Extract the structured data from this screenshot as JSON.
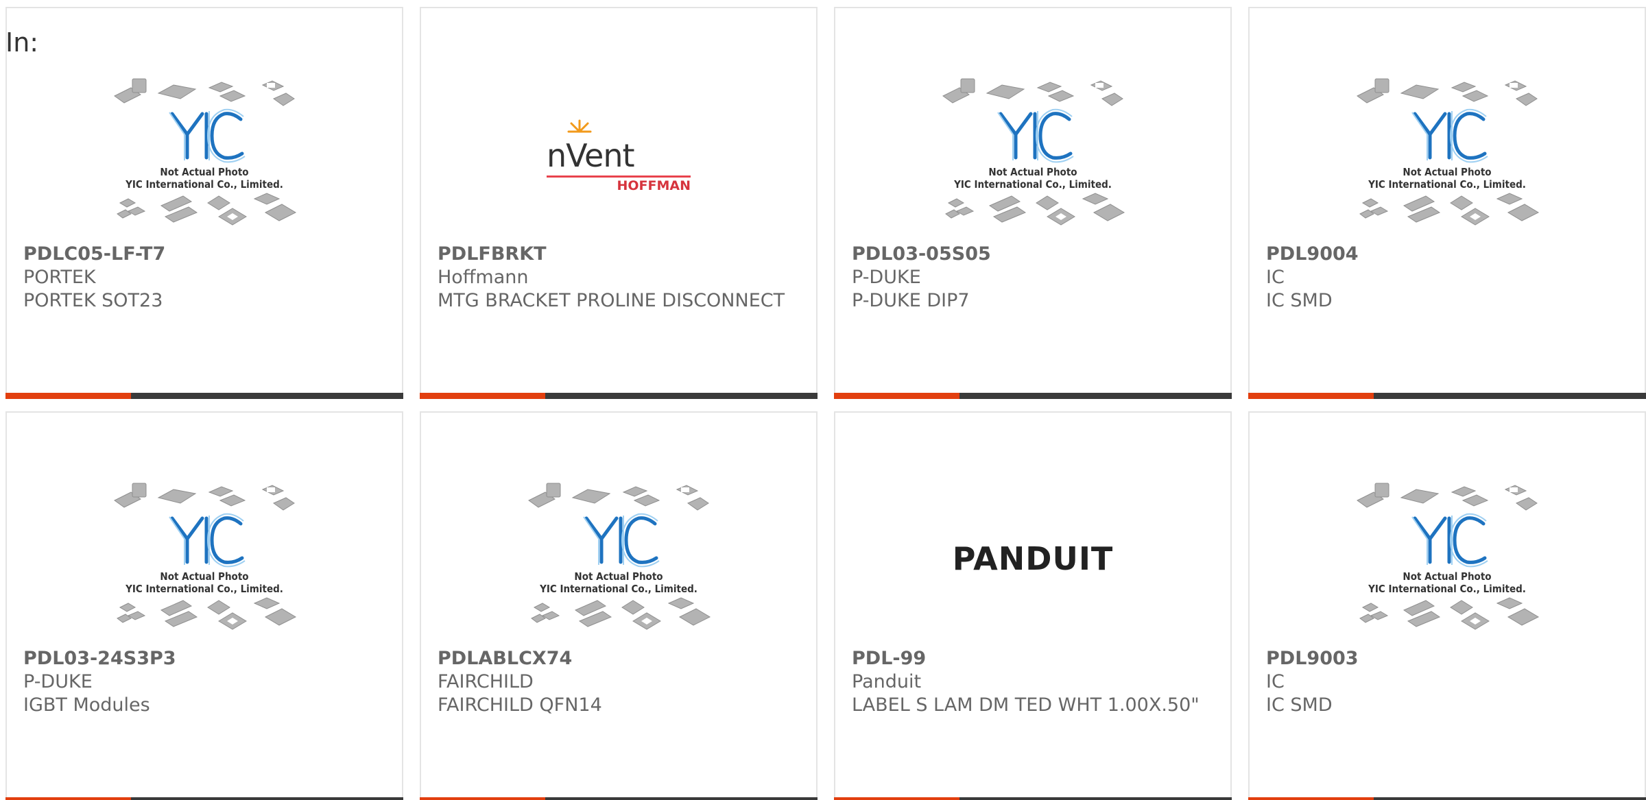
{
  "header": {
    "in_label": "In:"
  },
  "colors": {
    "accent": "#e23f0f",
    "bar": "#3a3a3a",
    "text": "#666666"
  },
  "placeholder": {
    "line1": "Not Actual Photo",
    "line2": "YIC International Co., Limited."
  },
  "logos": {
    "nvent_word": "nVent",
    "nvent_sub": "HOFFMAN",
    "panduit": "PANDUIT"
  },
  "products": [
    {
      "part": "PDLC05-LF-T7",
      "maker": "PORTEK",
      "desc": "PORTEK SOT23",
      "image": "yic-placeholder"
    },
    {
      "part": "PDLFBRKT",
      "maker": "Hoffmann",
      "desc": "MTG BRACKET PROLINE DISCONNECT",
      "image": "nvent-hoffman-logo"
    },
    {
      "part": "PDL03-05S05",
      "maker": "P-DUKE",
      "desc": "P-DUKE DIP7",
      "image": "yic-placeholder"
    },
    {
      "part": "PDL9004",
      "maker": "IC",
      "desc": "IC SMD",
      "image": "yic-placeholder"
    },
    {
      "part": "PDL03-24S3P3",
      "maker": "P-DUKE",
      "desc": "IGBT Modules",
      "image": "yic-placeholder"
    },
    {
      "part": "PDLABLCX74",
      "maker": "FAIRCHILD",
      "desc": "FAIRCHILD QFN14",
      "image": "yic-placeholder"
    },
    {
      "part": "PDL-99",
      "maker": "Panduit",
      "desc": "LABEL S LAM DM TED WHT 1.00X.50\"",
      "image": "panduit-logo"
    },
    {
      "part": "PDL9003",
      "maker": "IC",
      "desc": "IC SMD",
      "image": "yic-placeholder"
    }
  ]
}
